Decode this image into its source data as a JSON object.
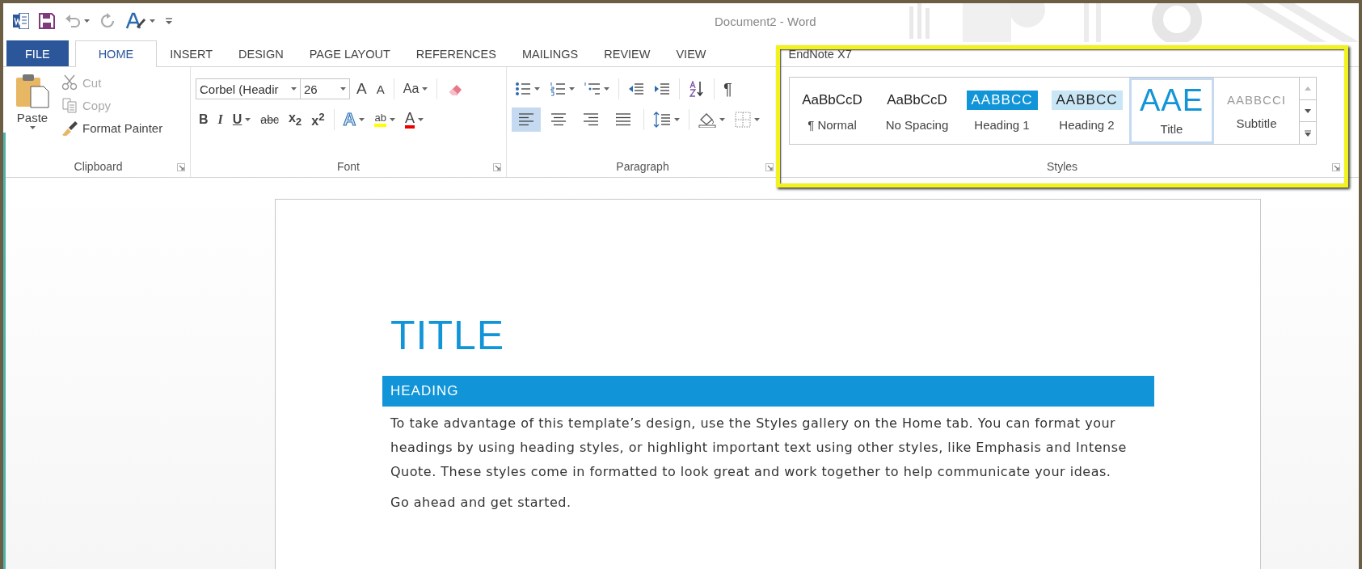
{
  "title_bar": {
    "title": "Document2 - Word"
  },
  "tabs": [
    {
      "label": "FILE",
      "kind": "file",
      "selected": false
    },
    {
      "label": "HOME",
      "kind": "tab",
      "selected": true
    },
    {
      "label": "INSERT",
      "kind": "tab",
      "selected": false
    },
    {
      "label": "DESIGN",
      "kind": "tab",
      "selected": false
    },
    {
      "label": "PAGE LAYOUT",
      "kind": "tab",
      "selected": false
    },
    {
      "label": "REFERENCES",
      "kind": "tab",
      "selected": false
    },
    {
      "label": "MAILINGS",
      "kind": "tab",
      "selected": false
    },
    {
      "label": "REVIEW",
      "kind": "tab",
      "selected": false
    },
    {
      "label": "VIEW",
      "kind": "tab",
      "selected": false
    },
    {
      "label": "EndNote X7",
      "kind": "tab",
      "selected": false
    }
  ],
  "clipboard": {
    "paste": "Paste",
    "cut": "Cut",
    "copy": "Copy",
    "format_painter": "Format Painter",
    "group": "Clipboard"
  },
  "font": {
    "name": "Corbel (Headir",
    "size": "26",
    "grow": "A",
    "shrink": "A",
    "change_case": "Aa",
    "bold": "B",
    "italic": "I",
    "underline": "U",
    "strikethrough": "abc",
    "subscript": "x$_{2}$",
    "superscript": "x$^{2}$",
    "text_effects": "A",
    "highlight": "ab",
    "font_color": "A",
    "group": "Font"
  },
  "paragraph": {
    "pilcrow": "¶",
    "alignment": [
      {
        "kind": "left",
        "selected": true
      },
      {
        "kind": "center",
        "selected": false
      },
      {
        "kind": "right",
        "selected": false
      },
      {
        "kind": "justify",
        "selected": false
      }
    ],
    "group": "Paragraph"
  },
  "styles": {
    "items": [
      {
        "sample": "AaBbCcD",
        "name": "¶ Normal",
        "kind": "normal",
        "selected": false
      },
      {
        "sample": "AaBbCcD",
        "name": "No Spacing",
        "kind": "normal",
        "selected": false
      },
      {
        "sample": "AABBCC",
        "name": "Heading 1",
        "kind": "heading1",
        "selected": false
      },
      {
        "sample": "AABBCC",
        "name": "Heading 2",
        "kind": "heading2",
        "selected": false
      },
      {
        "sample": "AAE",
        "name": "Title",
        "kind": "title",
        "selected": true
      },
      {
        "sample": "AABBCCI",
        "name": "Subtitle",
        "kind": "subtitle",
        "selected": false
      }
    ],
    "group": "Styles"
  },
  "document": {
    "title": "TITLE",
    "heading": "HEADING",
    "paragraphs": [
      "To take advantage of this template’s design, use the Styles gallery on the Home tab. You can format your headings by using heading styles, or highlight important text using other styles, like Emphasis and Intense Quote. These styles come in formatted to look great and work together to help communicate your ideas.",
      "Go ahead and get started."
    ]
  }
}
